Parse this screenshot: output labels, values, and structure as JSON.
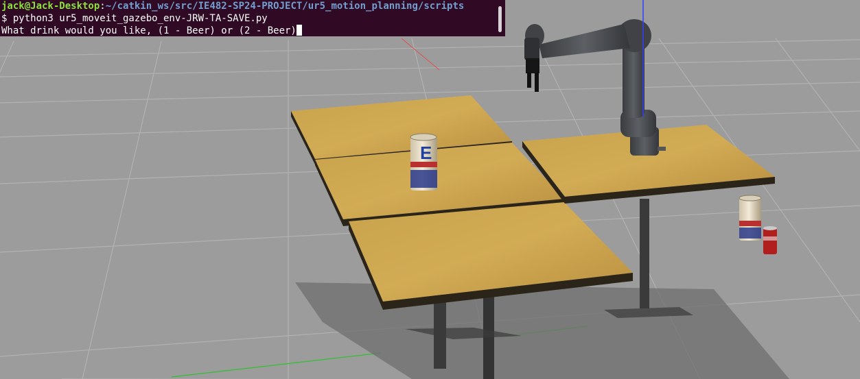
{
  "terminal": {
    "user_host": "jack@Jack-Desktop",
    "separator": ":",
    "path": "~/catkin_ws/src/IE482-SP24-PROJECT/ur5_motion_planning/scripts",
    "command": "$ python3 ur5_moveit_gazebo_env-JRW-TA-SAVE.py",
    "output": "What drink would you like, (1 - Beer) or (2 - Beer)"
  },
  "colors": {
    "ground": "#9c9c9c",
    "grid_line": "#b4b4b4",
    "table_top": "#c8a04a",
    "table_edge": "#2b2418",
    "robot": "#4a4d50",
    "terminal_bg": "#300a24",
    "x_axis": "#e05050",
    "y_axis": "#30c030",
    "z_axis": "#3040ff"
  },
  "can_labels": {
    "letter": "E",
    "band": "STEEL"
  }
}
